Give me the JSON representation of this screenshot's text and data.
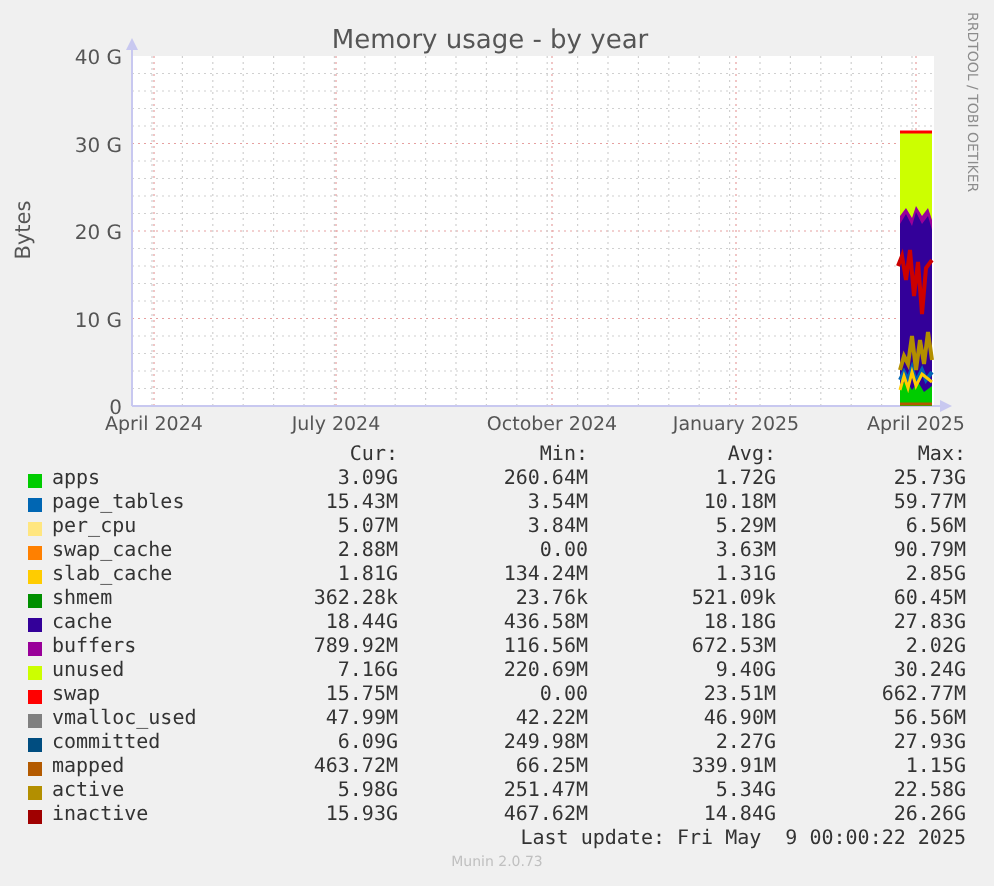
{
  "title": "Memory usage - by year",
  "credit": "RRDTOOL / TOBI OETIKER",
  "y_axis_label": "Bytes",
  "y_ticks": [
    "40 G",
    "30 G",
    "20 G",
    "10 G",
    "0"
  ],
  "x_ticks": [
    "April 2024",
    "July 2024",
    "October 2024",
    "January 2025",
    "April 2025"
  ],
  "legend": {
    "headers": [
      "Cur:",
      "Min:",
      "Avg:",
      "Max:"
    ],
    "rows": [
      {
        "name": "apps",
        "color": "#00cc00",
        "cur": "3.09G",
        "min": "260.64M",
        "avg": "1.72G",
        "max": "25.73G"
      },
      {
        "name": "page_tables",
        "color": "#0066b3",
        "cur": "15.43M",
        "min": "3.54M",
        "avg": "10.18M",
        "max": "59.77M"
      },
      {
        "name": "per_cpu",
        "color": "#ffe680",
        "cur": "5.07M",
        "min": "3.84M",
        "avg": "5.29M",
        "max": "6.56M"
      },
      {
        "name": "swap_cache",
        "color": "#ff8000",
        "cur": "2.88M",
        "min": "0.00",
        "avg": "3.63M",
        "max": "90.79M"
      },
      {
        "name": "slab_cache",
        "color": "#ffcc00",
        "cur": "1.81G",
        "min": "134.24M",
        "avg": "1.31G",
        "max": "2.85G"
      },
      {
        "name": "shmem",
        "color": "#008f00",
        "cur": "362.28k",
        "min": "23.76k",
        "avg": "521.09k",
        "max": "60.45M"
      },
      {
        "name": "cache",
        "color": "#330099",
        "cur": "18.44G",
        "min": "436.58M",
        "avg": "18.18G",
        "max": "27.83G"
      },
      {
        "name": "buffers",
        "color": "#990099",
        "cur": "789.92M",
        "min": "116.56M",
        "avg": "672.53M",
        "max": "2.02G"
      },
      {
        "name": "unused",
        "color": "#ccff00",
        "cur": "7.16G",
        "min": "220.69M",
        "avg": "9.40G",
        "max": "30.24G"
      },
      {
        "name": "swap",
        "color": "#ff0000",
        "cur": "15.75M",
        "min": "0.00",
        "avg": "23.51M",
        "max": "662.77M"
      },
      {
        "name": "vmalloc_used",
        "color": "#808080",
        "cur": "47.99M",
        "min": "42.22M",
        "avg": "46.90M",
        "max": "56.56M"
      },
      {
        "name": "committed",
        "color": "#004d80",
        "cur": "6.09G",
        "min": "249.98M",
        "avg": "2.27G",
        "max": "27.93G"
      },
      {
        "name": "mapped",
        "color": "#b35a00",
        "cur": "463.72M",
        "min": "66.25M",
        "avg": "339.91M",
        "max": "1.15G"
      },
      {
        "name": "active",
        "color": "#b38f00",
        "cur": "5.98G",
        "min": "251.47M",
        "avg": "5.34G",
        "max": "22.58G"
      },
      {
        "name": "inactive",
        "color": "#a00000",
        "cur": "15.93G",
        "min": "467.62M",
        "avg": "14.84G",
        "max": "26.26G"
      }
    ]
  },
  "last_update": "Last update: Fri May  9 00:00:22 2025",
  "footer": "Munin 2.0.73"
}
